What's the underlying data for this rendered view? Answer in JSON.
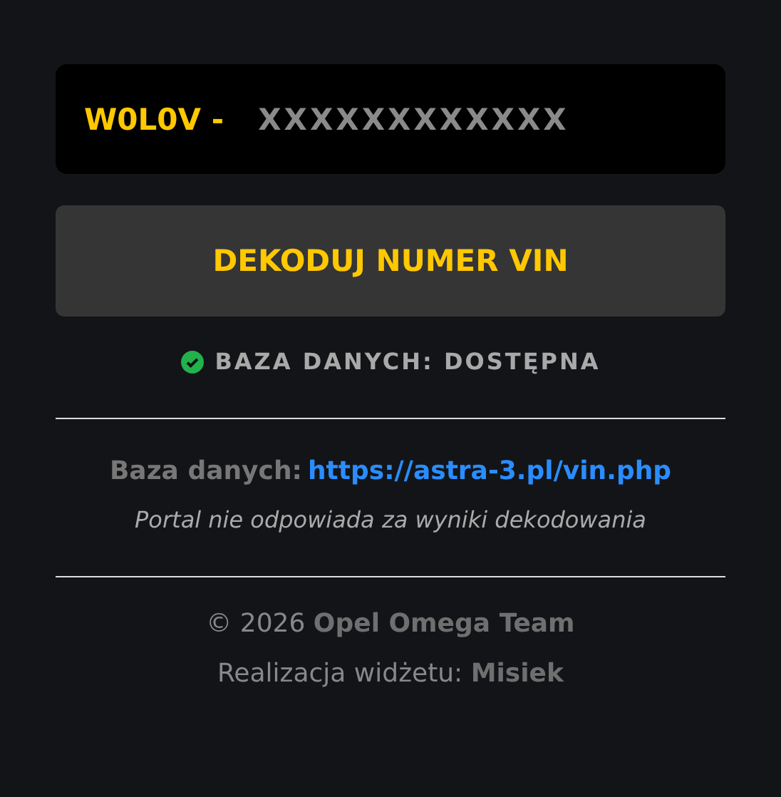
{
  "vin_field": {
    "prefix": "W0L0V -",
    "placeholder": "XXXXXXXXXXXX"
  },
  "decode_button": {
    "label": "DEKODUJ NUMER VIN"
  },
  "status": {
    "available": true,
    "text": "BAZA DANYCH: DOSTĘPNA"
  },
  "source": {
    "label": "Baza danych:",
    "link": "https://astra-3.pl/vin.php"
  },
  "disclaimer": "Portal nie odpowiada za wyniki dekodowania",
  "footer": {
    "copyright": "© 2026",
    "team": "Opel Omega Team",
    "credit_label": "Realizacja widżetu:",
    "credit_name": "Misiek"
  }
}
